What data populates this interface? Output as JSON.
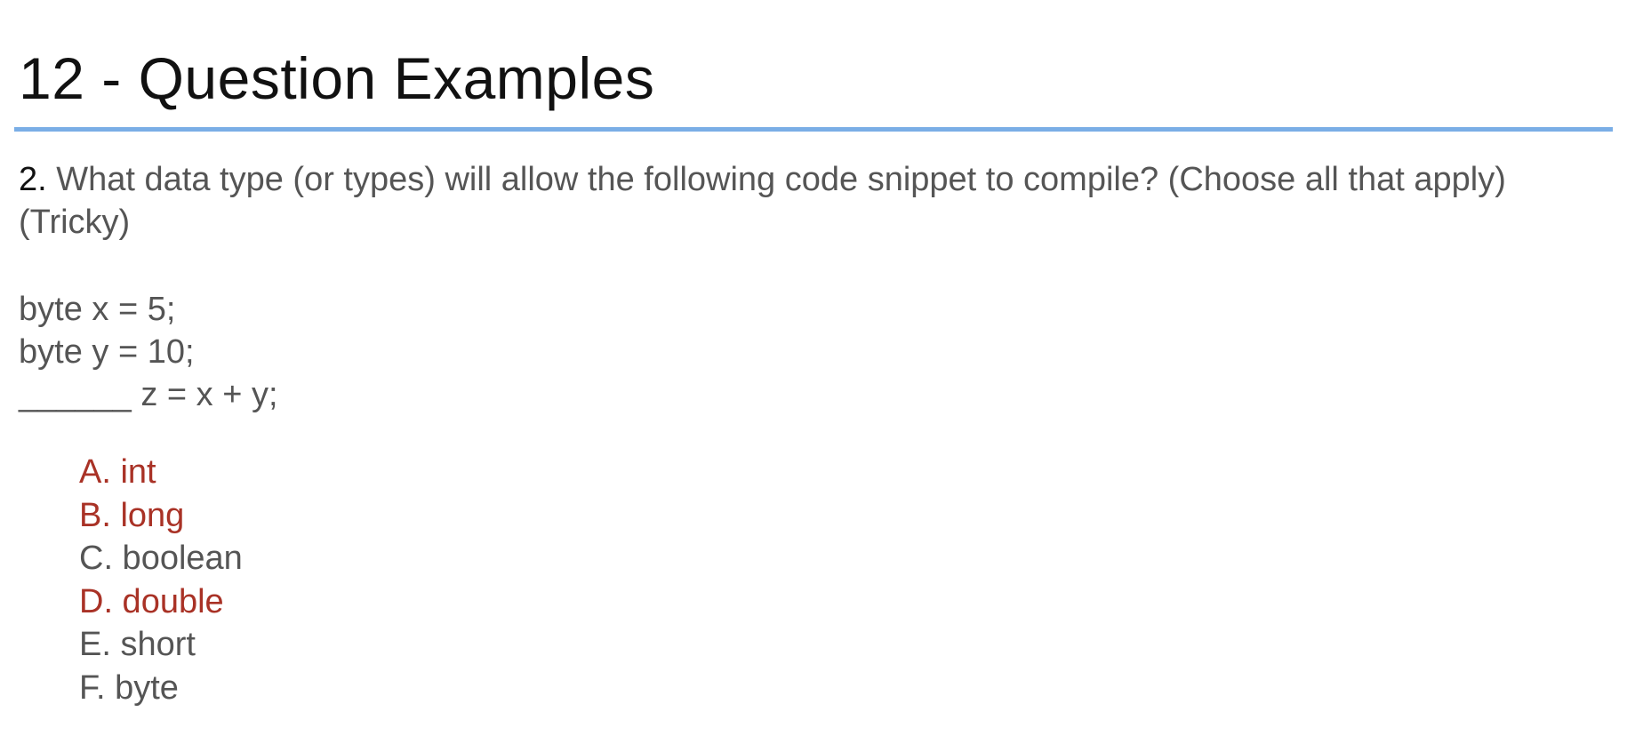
{
  "slide": {
    "title": "12 - Question Examples",
    "accent_color": "#7aaee6"
  },
  "question": {
    "number": "2.",
    "text": " What data type (or types) will allow the following code snippet to compile? (Choose all that apply) (Tricky)"
  },
  "code": {
    "lines": [
      "byte x = 5;",
      "byte y = 10;",
      "______ z = x + y;"
    ]
  },
  "options": [
    {
      "label": "A. int",
      "highlighted": true
    },
    {
      "label": "B. long",
      "highlighted": true
    },
    {
      "label": "C. boolean",
      "highlighted": false
    },
    {
      "label": "D. double",
      "highlighted": true
    },
    {
      "label": "E. short",
      "highlighted": false
    },
    {
      "label": "F. byte",
      "highlighted": false
    }
  ],
  "colors": {
    "highlight": "#a93226",
    "body_text": "#555555",
    "title_text": "#111111"
  }
}
